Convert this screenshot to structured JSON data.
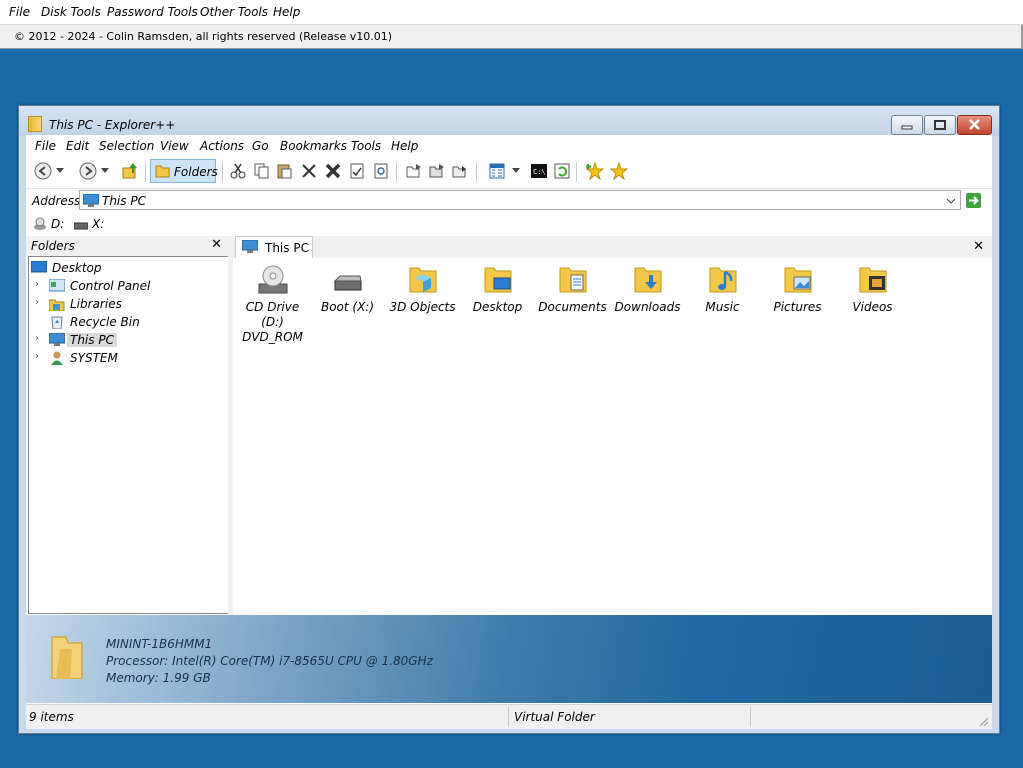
{
  "host": {
    "menu": [
      "File",
      "Disk Tools",
      "Password Tools",
      "Other Tools",
      "Help"
    ],
    "status": "© 2012 - 2024 - Colin Ramsden, all rights reserved (Release v10.01)"
  },
  "window": {
    "title": "This PC - Explorer++",
    "menu": [
      "File",
      "Edit",
      "Selection",
      "View",
      "Actions",
      "Go",
      "Bookmarks",
      "Tools",
      "Help"
    ],
    "toolbar": {
      "folders_label": "Folders",
      "icons": [
        "back-icon",
        "back-dropdown-icon",
        "forward-icon",
        "forward-dropdown-icon",
        "up-icon",
        "folders-icon",
        "cut-icon",
        "copy-icon",
        "paste-icon",
        "delete-icon",
        "delete-permanently-icon",
        "properties-icon",
        "search-icon",
        "copy-to-icon",
        "move-to-icon",
        "new-folder-icon",
        "views-icon",
        "views-dropdown-icon",
        "command-prompt-icon",
        "refresh-icon",
        "add-bookmark-icon",
        "bookmarks-icon"
      ]
    },
    "address": {
      "label": "Address",
      "value": "This PC"
    },
    "drives": [
      "D:",
      "X:"
    ],
    "folders_pane": {
      "title": "Folders",
      "tree": [
        {
          "label": "Desktop",
          "level": 0
        },
        {
          "label": "Control Panel",
          "level": 1
        },
        {
          "label": "Libraries",
          "level": 1
        },
        {
          "label": "Recycle Bin",
          "level": 1
        },
        {
          "label": "This PC",
          "level": 1,
          "selected": true
        },
        {
          "label": "SYSTEM",
          "level": 1
        }
      ]
    },
    "tab": {
      "label": "This PC"
    },
    "items": [
      {
        "label": "CD Drive (D:)\nDVD_ROM",
        "line1": "CD Drive (D:)",
        "line2": "DVD_ROM",
        "icon": "cd-drive-icon"
      },
      {
        "label": "Boot (X:)",
        "line1": "Boot (X:)",
        "line2": "",
        "icon": "hard-drive-icon"
      },
      {
        "label": "3D Objects",
        "line1": "3D Objects",
        "line2": "",
        "icon": "3d-objects-folder-icon"
      },
      {
        "label": "Desktop",
        "line1": "Desktop",
        "line2": "",
        "icon": "desktop-folder-icon"
      },
      {
        "label": "Documents",
        "line1": "Documents",
        "line2": "",
        "icon": "documents-folder-icon"
      },
      {
        "label": "Downloads",
        "line1": "Downloads",
        "line2": "",
        "icon": "downloads-folder-icon"
      },
      {
        "label": "Music",
        "line1": "Music",
        "line2": "",
        "icon": "music-folder-icon"
      },
      {
        "label": "Pictures",
        "line1": "Pictures",
        "line2": "",
        "icon": "pictures-folder-icon"
      },
      {
        "label": "Videos",
        "line1": "Videos",
        "line2": "",
        "icon": "videos-folder-icon"
      }
    ],
    "info": {
      "computer": "MININT-1B6HMM1",
      "processor": "Processor: Intel(R) Core(TM) i7-8565U CPU @ 1.80GHz",
      "memory": "Memory: 1.99 GB"
    },
    "status": {
      "count": "9 items",
      "type": "Virtual Folder"
    }
  }
}
